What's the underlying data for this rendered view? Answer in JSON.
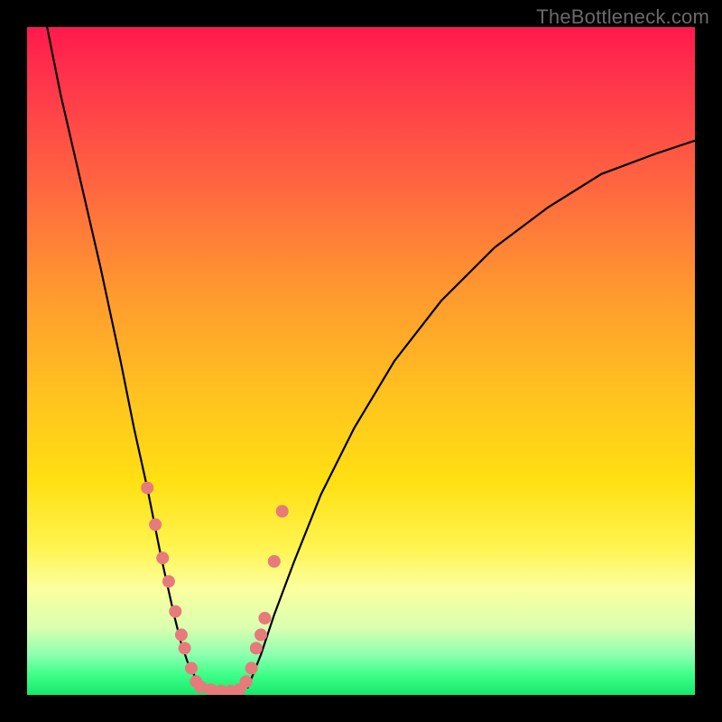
{
  "watermark": "TheBottleneck.com",
  "chart_data": {
    "type": "line",
    "title": "",
    "xlabel": "",
    "ylabel": "",
    "xlim": [
      0,
      100
    ],
    "ylim": [
      0,
      100
    ],
    "series": [
      {
        "name": "left-curve",
        "x": [
          3,
          5,
          8,
          11,
          14,
          16,
          18,
          20,
          22,
          23,
          24,
          25,
          26
        ],
        "values": [
          100,
          90,
          77,
          64,
          50,
          40,
          31,
          21,
          12,
          8,
          5,
          3,
          1
        ]
      },
      {
        "name": "right-curve",
        "x": [
          33,
          35,
          37,
          40,
          44,
          49,
          55,
          62,
          70,
          78,
          86,
          94,
          100
        ],
        "values": [
          1,
          6,
          12,
          20,
          30,
          40,
          50,
          59,
          67,
          73,
          78,
          81,
          83
        ]
      },
      {
        "name": "left-arm-dots",
        "type": "scatter",
        "x": [
          18.0,
          19.2,
          20.3,
          21.2,
          22.2,
          23.1,
          23.6,
          24.6,
          25.3,
          26.0
        ],
        "values": [
          31.0,
          25.5,
          20.5,
          17.0,
          12.5,
          9.0,
          7.0,
          4.0,
          2.0,
          1.2
        ]
      },
      {
        "name": "right-arm-dots",
        "type": "scatter",
        "x": [
          32.8,
          33.6,
          34.3,
          35.0,
          35.6,
          37.0,
          38.2
        ],
        "values": [
          2.0,
          4.0,
          7.0,
          9.0,
          11.5,
          20.0,
          27.5
        ]
      },
      {
        "name": "bottom-dots",
        "type": "scatter",
        "x": [
          27.5,
          29.0,
          30.5,
          31.8
        ],
        "values": [
          0.8,
          0.6,
          0.6,
          0.8
        ]
      }
    ]
  }
}
